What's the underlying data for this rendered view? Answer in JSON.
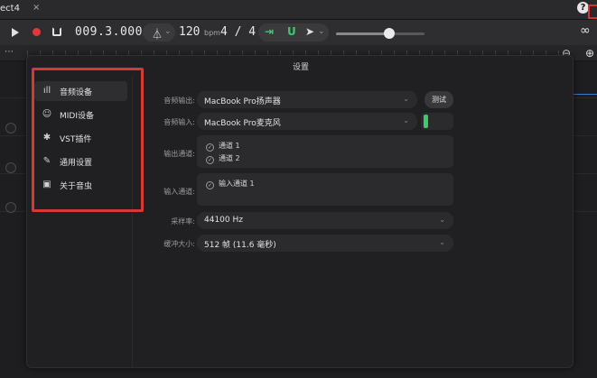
{
  "window": {
    "tab_title": "ect4",
    "tab_close": "×"
  },
  "toolbar": {
    "position": "009.3.000",
    "bpm": "120",
    "bpm_unit": "bpm",
    "time_signature": "4 / 4",
    "zoom_slider_value": 0.6
  },
  "modal": {
    "title": "设置",
    "nav": [
      {
        "label": "音频设备",
        "icon": "waveform-icon",
        "active": true
      },
      {
        "label": "MIDI设备",
        "icon": "midi-icon",
        "active": false
      },
      {
        "label": "VST插件",
        "icon": "plugin-icon",
        "active": false
      },
      {
        "label": "通用设置",
        "icon": "wrench-icon",
        "active": false
      },
      {
        "label": "关于音虫",
        "icon": "briefcase-icon",
        "active": false
      }
    ],
    "audio": {
      "output_label": "音频输出:",
      "output_value": "MacBook Pro扬声器",
      "test_button": "测试",
      "input_label": "音频输入:",
      "input_value": "MacBook Pro麦克风",
      "output_channels_label": "输出通道:",
      "output_channels": [
        "通道 1",
        "通道 2"
      ],
      "input_channels_label": "输入通道:",
      "input_channels": [
        "输入通道 1"
      ],
      "sample_rate_label": "采样率:",
      "sample_rate_value": "44100 Hz",
      "buffer_label": "缓冲大小:",
      "buffer_value": "512 帧 (11.6 毫秒)"
    }
  },
  "colors": {
    "accent_green": "#3ec96b",
    "record_red": "#e0393b",
    "highlight_red": "#d8392e",
    "playhead_blue": "#3d7bd0"
  }
}
